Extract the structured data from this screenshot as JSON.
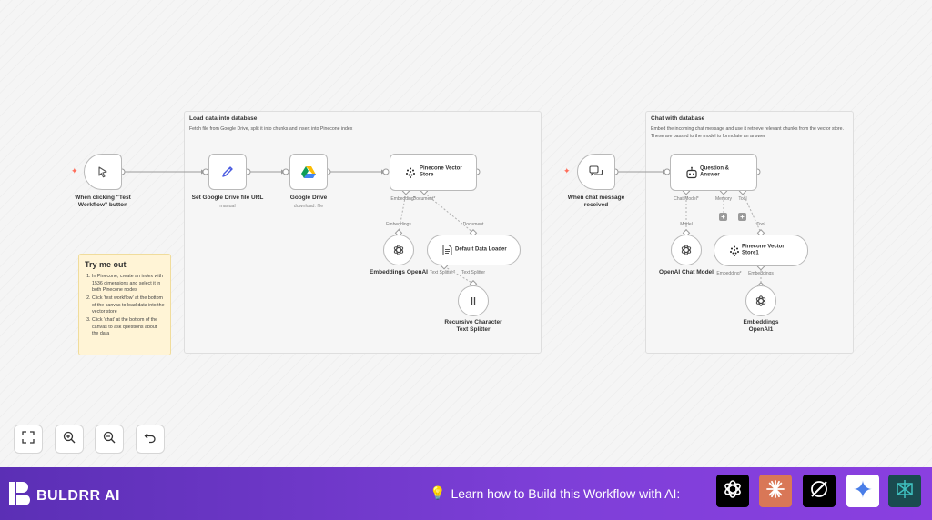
{
  "groups": {
    "load": {
      "title": "Load data into database",
      "description": "Fetch file from Google Drive, split it into chunks and insert into Pinecone index"
    },
    "chat": {
      "title": "Chat with database",
      "description": "Embed the incoming chat message and use it retrieve relevant chunks from the vector store. These are passed to the model to formulate an answer"
    }
  },
  "note": {
    "title": "Try me out",
    "items": [
      "In Pinecone, create an index with 1536 dimensions and select it in both Pinecone nodes",
      "Click 'test workflow' at the bottom of the canvas to load data into the vector store",
      "Click 'chat' at the bottom of the canvas to ask questions about the data"
    ]
  },
  "nodes": {
    "manual_trigger": {
      "label_line1": "When clicking \"Test",
      "label_line2": "Workflow\" button",
      "icon": "cursor-icon"
    },
    "set_url": {
      "label": "Set Google Drive file URL",
      "subtitle": "manual",
      "icon": "pencil-icon"
    },
    "google_drive": {
      "label": "Google Drive",
      "subtitle": "download: file",
      "icon": "google-drive-icon"
    },
    "pinecone_store": {
      "label_line1": "Pinecone Vector",
      "label_line2": "Store",
      "icon": "pinecone-icon"
    },
    "embeddings": {
      "label": "Embeddings OpenAI",
      "icon": "openai-icon"
    },
    "default_loader": {
      "label": "Default Data Loader",
      "icon": "document-icon"
    },
    "splitter": {
      "label_line1": "Recursive Character",
      "label_line2": "Text Splitter",
      "icon": "splitter-icon"
    },
    "chat_trigger": {
      "label_line1": "When chat message",
      "label_line2": "received",
      "icon": "chat-icon"
    },
    "qa": {
      "label_line1": "Question &",
      "label_line2": "Answer",
      "icon": "robot-icon"
    },
    "chat_model": {
      "label": "OpenAI Chat Model",
      "icon": "openai-icon"
    },
    "pinecone_store1": {
      "label_line1": "Pinecone Vector",
      "label_line2": "Store1",
      "icon": "pinecone-icon"
    },
    "embeddings1": {
      "label_line1": "Embeddings",
      "label_line2": "OpenAI1",
      "icon": "openai-icon"
    }
  },
  "ports": {
    "embedding": "Embedding*",
    "document_star": "Document*",
    "embeddings": "Embeddings",
    "document": "Document",
    "text_splitter_star": "Text Splitter*",
    "text_splitter": "Text Splitter",
    "chat_model_star": "Chat Model*",
    "memory": "Memory",
    "tool": "Tool",
    "model": "Model",
    "tool2": "Tool",
    "embedding2": "Embedding*",
    "embeddings2": "Embeddings"
  },
  "controls": [
    "fit-view-icon",
    "zoom-in-icon",
    "zoom-out-icon",
    "undo-icon"
  ],
  "footer": {
    "brand": "BULDRR AI",
    "learn_text": "Learn how to Build this Workflow with AI:",
    "ai_tools": [
      "openai-icon",
      "claude-icon",
      "grok-icon",
      "gemini-icon",
      "perplexity-icon"
    ]
  },
  "colors": {
    "accent": "#ff6d5a",
    "footer_start": "#5b2fb5",
    "footer_end": "#8a3fe0",
    "note_bg": "#fff4d6"
  }
}
